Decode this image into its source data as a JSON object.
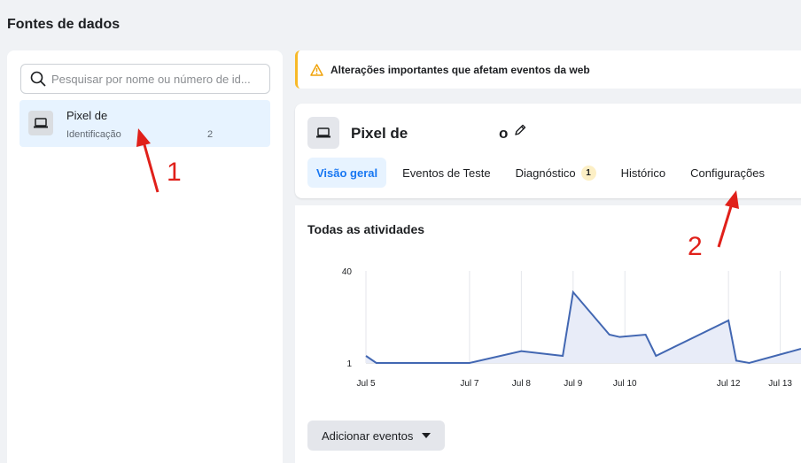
{
  "page": {
    "title": "Fontes de dados"
  },
  "sidebar": {
    "search_placeholder": "Pesquisar por nome ou número de id...",
    "pixel": {
      "name": "Pixel de",
      "sub_label": "Identificação",
      "sub_suffix": "2"
    }
  },
  "alert": {
    "text": "Alterações importantes que afetam eventos da web"
  },
  "pixel_card": {
    "title": "Pixel de",
    "title_suffix": "o",
    "tabs": [
      {
        "label": "Visão geral"
      },
      {
        "label": "Eventos de Teste"
      },
      {
        "label": "Diagnóstico",
        "badge": "1"
      },
      {
        "label": "Histórico"
      },
      {
        "label": "Configurações"
      }
    ]
  },
  "activity": {
    "heading": "Todas as atividades",
    "add_events_label": "Adicionar eventos"
  },
  "chart_data": {
    "type": "area",
    "x": [
      "Jul 5",
      "Jul 5.5",
      "Jul 6",
      "Jul 7",
      "Jul 8",
      "Jul 8.8",
      "Jul 9",
      "Jul 9.7",
      "Jul 10",
      "Jul 10.4",
      "Jul 10.6",
      "Jul 12",
      "Jul 12.2",
      "Jul 12.5",
      "Jul 13"
    ],
    "x_numeric": [
      5,
      5.2,
      6,
      7,
      8,
      8.8,
      9,
      9.7,
      9.9,
      10.4,
      10.6,
      12,
      12.15,
      12.4,
      13.4
    ],
    "values": [
      4,
      1,
      1,
      1,
      6,
      4,
      31,
      13,
      12,
      13,
      4,
      19,
      2,
      1,
      7
    ],
    "tick_labels_x": [
      "Jul 5",
      "Jul 7",
      "Jul 8",
      "Jul 9",
      "Jul 10",
      "Jul 12",
      "Jul 13"
    ],
    "tick_labels_y": [
      "1",
      "40"
    ],
    "ylim": [
      1,
      40
    ],
    "line_color": "#4267b2",
    "fill_color": "#e8ecf8"
  },
  "annotations": {
    "label_1": "1",
    "label_2": "2",
    "color": "#e0201a"
  }
}
